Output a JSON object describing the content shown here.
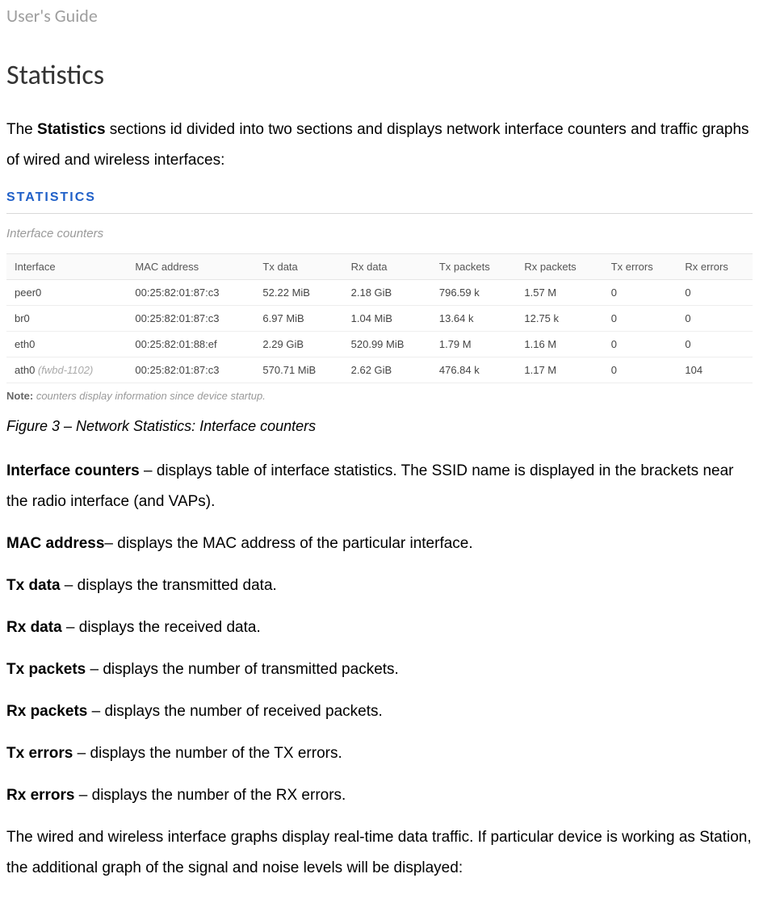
{
  "doc_header": "User's Guide",
  "h1": "Statistics",
  "intro_prefix": "The ",
  "intro_bold": "Statistics",
  "intro_rest": " sections id divided into two sections and displays network interface counters and traffic graphs of wired and wireless interfaces:",
  "screenshot": {
    "title": "STATISTICS",
    "subtitle": "Interface counters",
    "columns": [
      "Interface",
      "MAC address",
      "Tx data",
      "Rx data",
      "Tx packets",
      "Rx packets",
      "Tx errors",
      "Rx errors"
    ],
    "rows": [
      {
        "iface": "peer0",
        "ssid": "",
        "mac": "00:25:82:01:87:c3",
        "txd": "52.22 MiB",
        "rxd": "2.18 GiB",
        "txp": "796.59 k",
        "rxp": "1.57 M",
        "txe": "0",
        "rxe": "0"
      },
      {
        "iface": "br0",
        "ssid": "",
        "mac": "00:25:82:01:87:c3",
        "txd": "6.97 MiB",
        "rxd": "1.04 MiB",
        "txp": "13.64 k",
        "rxp": "12.75 k",
        "txe": "0",
        "rxe": "0"
      },
      {
        "iface": "eth0",
        "ssid": "",
        "mac": "00:25:82:01:88:ef",
        "txd": "2.29 GiB",
        "rxd": "520.99 MiB",
        "txp": "1.79 M",
        "rxp": "1.16 M",
        "txe": "0",
        "rxe": "0"
      },
      {
        "iface": "ath0",
        "ssid": "(fwbd-1102)",
        "mac": "00:25:82:01:87:c3",
        "txd": "570.71 MiB",
        "rxd": "2.62 GiB",
        "txp": "476.84 k",
        "rxp": "1.17 M",
        "txe": "0",
        "rxe": "104"
      }
    ],
    "note_label": "Note:",
    "note_text": " counters display information since device startup."
  },
  "figure_caption": "Figure 3 – Network Statistics: Interface counters",
  "defs": [
    {
      "term": "Interface counters",
      "sep": " – ",
      "text": "displays table of interface statistics. The SSID name is displayed in the brackets near the radio interface (and VAPs)."
    },
    {
      "term": "MAC address",
      "sep": "– ",
      "text": "displays the MAC address of the particular interface."
    },
    {
      "term": "Tx data",
      "sep": " – ",
      "text": "displays the transmitted data."
    },
    {
      "term": "Rx data",
      "sep": " – ",
      "text": "displays the received data."
    },
    {
      "term": "Tx packets",
      "sep": " – ",
      "text": "displays the number of transmitted packets."
    },
    {
      "term": "Rx packets",
      "sep": " – ",
      "text": "displays the number of received packets."
    },
    {
      "term": "Tx errors",
      "sep": " – ",
      "text": "displays the number of the TX errors."
    },
    {
      "term": "Rx errors",
      "sep": " – ",
      "text": "displays the number of the RX errors."
    }
  ],
  "closing": "The wired and wireless interface graphs display real-time data traffic. If particular device is working as Station, the additional graph of the signal and noise levels will be displayed:"
}
